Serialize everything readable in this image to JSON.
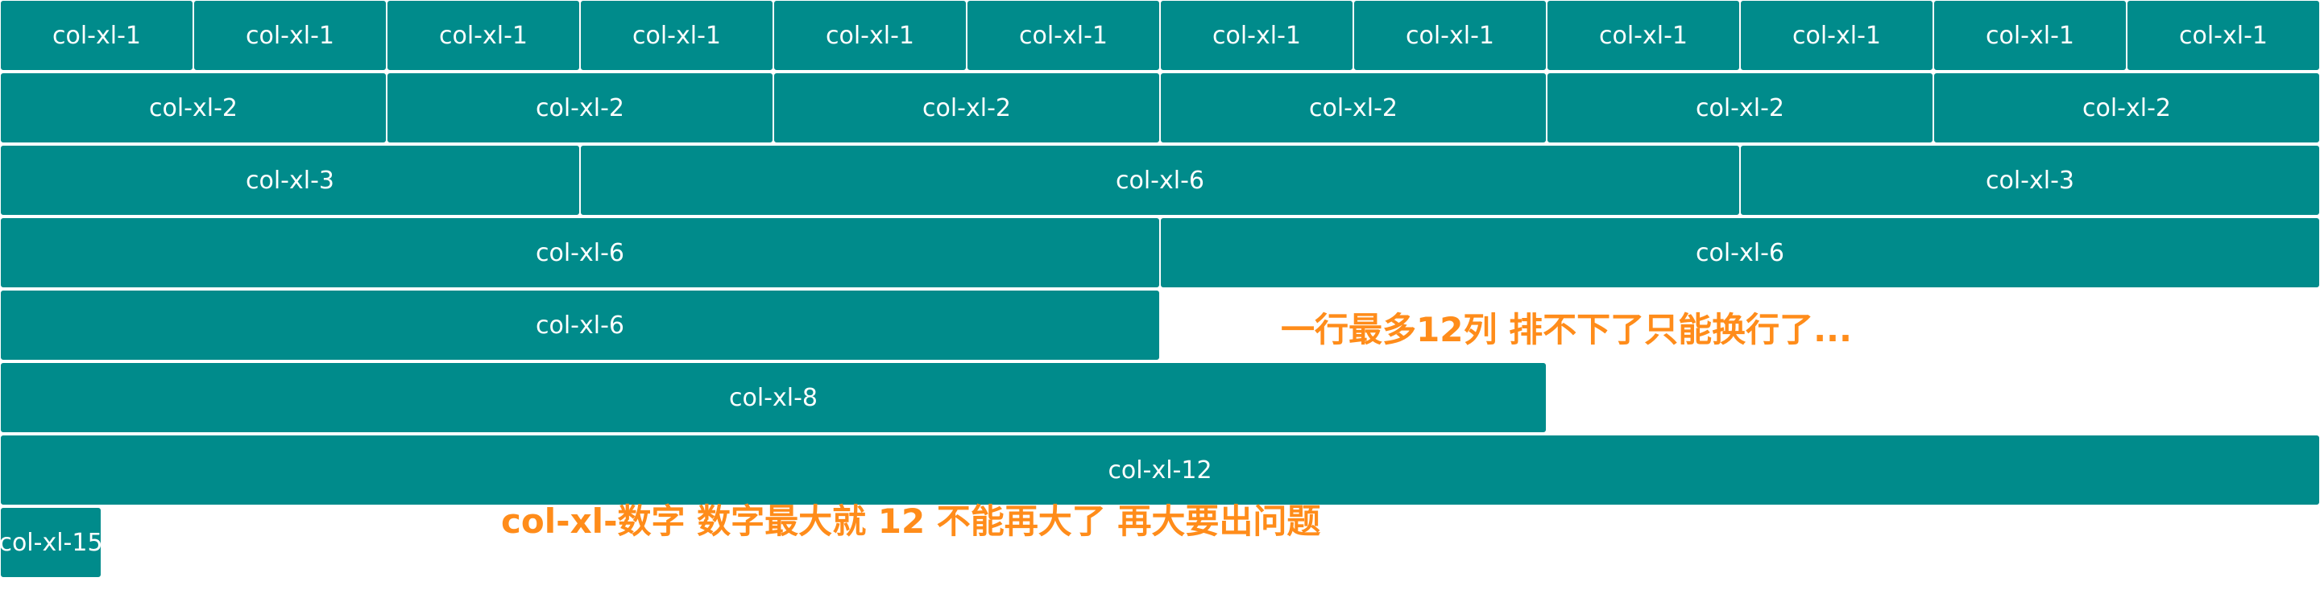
{
  "theme": {
    "cell_color": "#008b8b",
    "text_color": "#ffffff",
    "note_color": "#ff8c1a"
  },
  "grid": {
    "columns_per_row": 12,
    "rows": [
      {
        "cells": [
          {
            "span": 1,
            "label": "col-xl-1"
          },
          {
            "span": 1,
            "label": "col-xl-1"
          },
          {
            "span": 1,
            "label": "col-xl-1"
          },
          {
            "span": 1,
            "label": "col-xl-1"
          },
          {
            "span": 1,
            "label": "col-xl-1"
          },
          {
            "span": 1,
            "label": "col-xl-1"
          },
          {
            "span": 1,
            "label": "col-xl-1"
          },
          {
            "span": 1,
            "label": "col-xl-1"
          },
          {
            "span": 1,
            "label": "col-xl-1"
          },
          {
            "span": 1,
            "label": "col-xl-1"
          },
          {
            "span": 1,
            "label": "col-xl-1"
          },
          {
            "span": 1,
            "label": "col-xl-1"
          }
        ]
      },
      {
        "cells": [
          {
            "span": 2,
            "label": "col-xl-2"
          },
          {
            "span": 2,
            "label": "col-xl-2"
          },
          {
            "span": 2,
            "label": "col-xl-2"
          },
          {
            "span": 2,
            "label": "col-xl-2"
          },
          {
            "span": 2,
            "label": "col-xl-2"
          },
          {
            "span": 2,
            "label": "col-xl-2"
          }
        ]
      },
      {
        "cells": [
          {
            "span": 3,
            "label": "col-xl-3"
          },
          {
            "span": 6,
            "label": "col-xl-6"
          },
          {
            "span": 3,
            "label": "col-xl-3"
          }
        ]
      },
      {
        "cells": [
          {
            "span": 6,
            "label": "col-xl-6"
          },
          {
            "span": 6,
            "label": "col-xl-6"
          }
        ]
      },
      {
        "cells": [
          {
            "span": 6,
            "label": "col-xl-6"
          }
        ]
      },
      {
        "cells": [
          {
            "span": 8,
            "label": "col-xl-8"
          }
        ]
      },
      {
        "cells": [
          {
            "span": 12,
            "label": "col-xl-12"
          }
        ]
      },
      {
        "cells": [
          {
            "span": 15,
            "label": "col-xl-15"
          }
        ]
      }
    ]
  },
  "annotations": {
    "note_1": "一行最多12列 排不下了只能换行了...",
    "note_2": "col-xl-数字  数字最大就 12 不能再大了 再大要出问题"
  }
}
